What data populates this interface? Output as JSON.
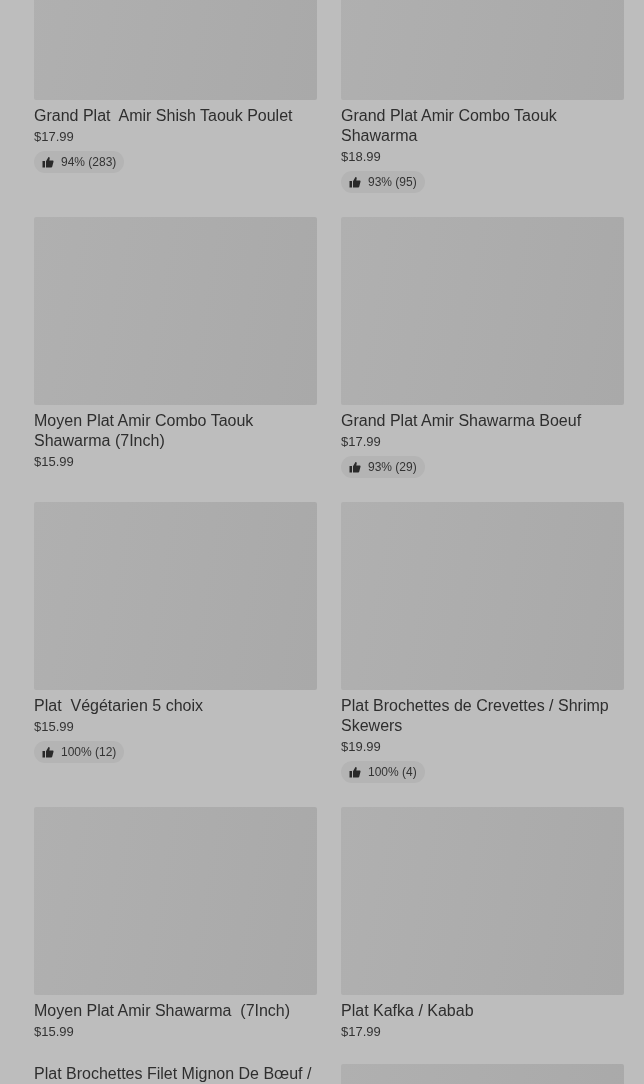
{
  "items": [
    {
      "name": "Grand Plat  Amir Shish Taouk Poulet",
      "price": "$17.99",
      "rating": "94% (283)",
      "has_image": true
    },
    {
      "name": "Grand Plat Amir Combo Taouk Shawarma",
      "price": "$18.99",
      "rating": "93% (95)",
      "has_image": true
    },
    {
      "name": "Moyen Plat Amir Combo Taouk Shawarma (7Inch)",
      "price": "$15.99",
      "has_image": true
    },
    {
      "name": "Grand Plat Amir Shawarma Boeuf",
      "price": "$17.99",
      "rating": "93% (29)",
      "has_image": true
    },
    {
      "name": "Plat  Végétarien 5 choix",
      "price": "$15.99",
      "rating": "100% (12)",
      "has_image": true
    },
    {
      "name": "Plat Brochettes de Crevettes / Shrimp Skewers",
      "price": "$19.99",
      "rating": "100% (4)",
      "has_image": true
    },
    {
      "name": "Moyen Plat Amir Shawarma  (7Inch)",
      "price": "$15.99",
      "has_image": true
    },
    {
      "name": "Plat Kafka / Kabab",
      "price": "$17.99",
      "has_image": true
    },
    {
      "name": "Plat Brochettes Filet Mignon De Bœuf /",
      "has_image": false
    },
    {
      "has_image": true
    }
  ]
}
